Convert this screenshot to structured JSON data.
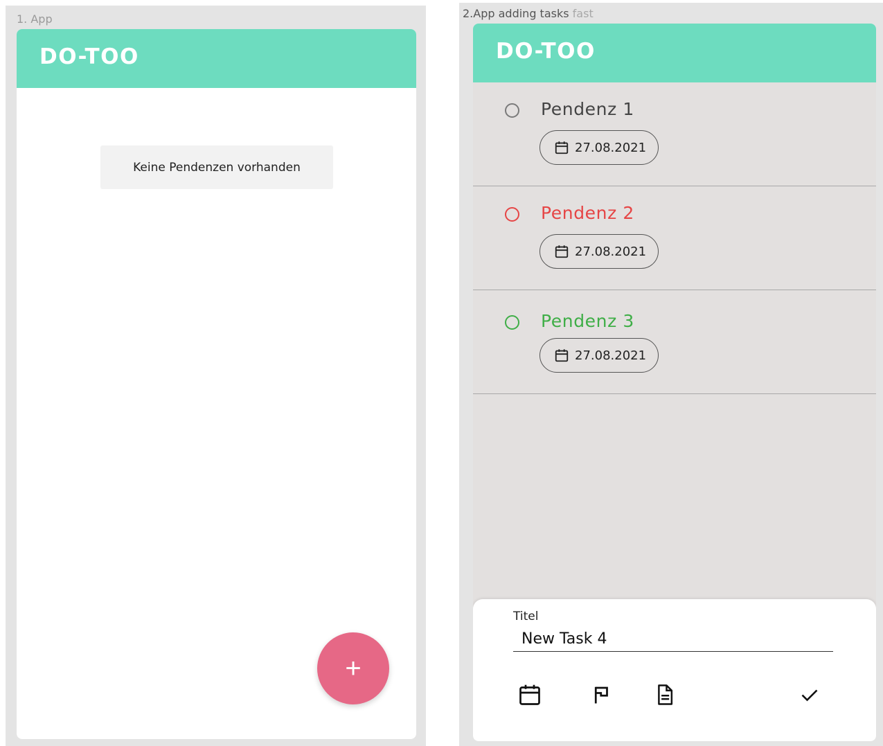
{
  "frames": [
    {
      "label": "1. App",
      "app_title": "DO-TOO",
      "empty_message": "Keine Pendenzen vorhanden",
      "fab_label": "+"
    },
    {
      "label_main": "2.App adding tasks",
      "label_extra": "fast",
      "app_title": "DO-TOO",
      "tasks": [
        {
          "title": "Pendenz 1",
          "date": "27.08.2021",
          "color": "#444444",
          "radio_color": "#7a7a7a"
        },
        {
          "title": "Pendenz 2",
          "date": "27.08.2021",
          "color": "#e64545",
          "radio_color": "#e64545"
        },
        {
          "title": "Pendenz 3",
          "date": "27.08.2021",
          "color": "#3fae47",
          "radio_color": "#3fae47"
        }
      ],
      "sheet": {
        "field_label": "Titel",
        "field_value": "New Task 4",
        "icons": [
          "calendar-icon",
          "flag-icon",
          "note-icon",
          "check-icon"
        ]
      }
    }
  ],
  "colors": {
    "appbar": "#6ddcbf",
    "fab": "#e66886",
    "list_bg": "#e3e0df",
    "frame_bg": "#e4e4e4"
  }
}
